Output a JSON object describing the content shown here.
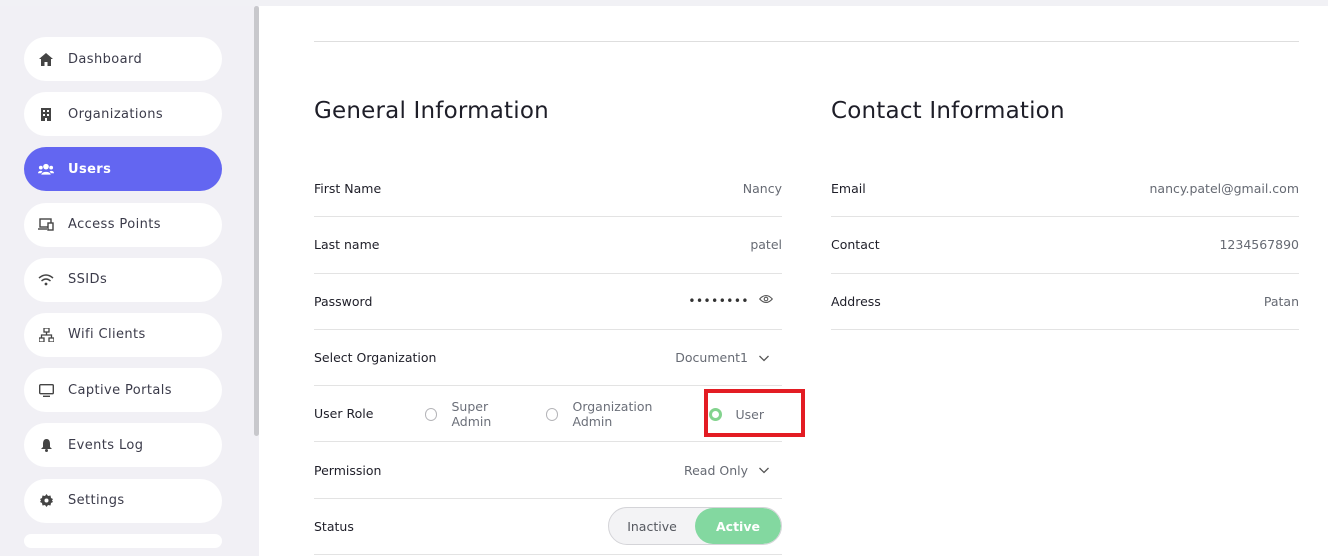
{
  "sidebar": {
    "items": [
      {
        "label": "Dashboard",
        "icon": "home-icon"
      },
      {
        "label": "Organizations",
        "icon": "building-icon"
      },
      {
        "label": "Users",
        "icon": "users-icon",
        "active": true
      },
      {
        "label": "Access Points",
        "icon": "devices-icon"
      },
      {
        "label": "SSIDs",
        "icon": "wifi-icon"
      },
      {
        "label": "Wifi Clients",
        "icon": "network-icon"
      },
      {
        "label": "Captive Portals",
        "icon": "monitor-icon"
      },
      {
        "label": "Events Log",
        "icon": "bell-icon"
      },
      {
        "label": "Settings",
        "icon": "gear-icon"
      }
    ],
    "accent_color": "#6366f1"
  },
  "general": {
    "title": "General Information",
    "first_name_label": "First Name",
    "first_name_value": "Nancy",
    "last_name_label": "Last name",
    "last_name_value": "patel",
    "password_label": "Password",
    "password_value": "••••••••",
    "organization_label": "Select Organization",
    "organization_value": "Document1",
    "role_label": "User Role",
    "roles": [
      "Super Admin",
      "Organization Admin",
      "User"
    ],
    "selected_role": "User",
    "permission_label": "Permission",
    "permission_value": "Read Only",
    "status_label": "Status",
    "status_off": "Inactive",
    "status_on": "Active",
    "status_active_color": "#83d8a0"
  },
  "contact": {
    "title": "Contact Information",
    "email_label": "Email",
    "email_value": "nancy.patel@gmail.com",
    "contact_label": "Contact",
    "contact_value": "1234567890",
    "address_label": "Address",
    "address_value": "Patan"
  }
}
